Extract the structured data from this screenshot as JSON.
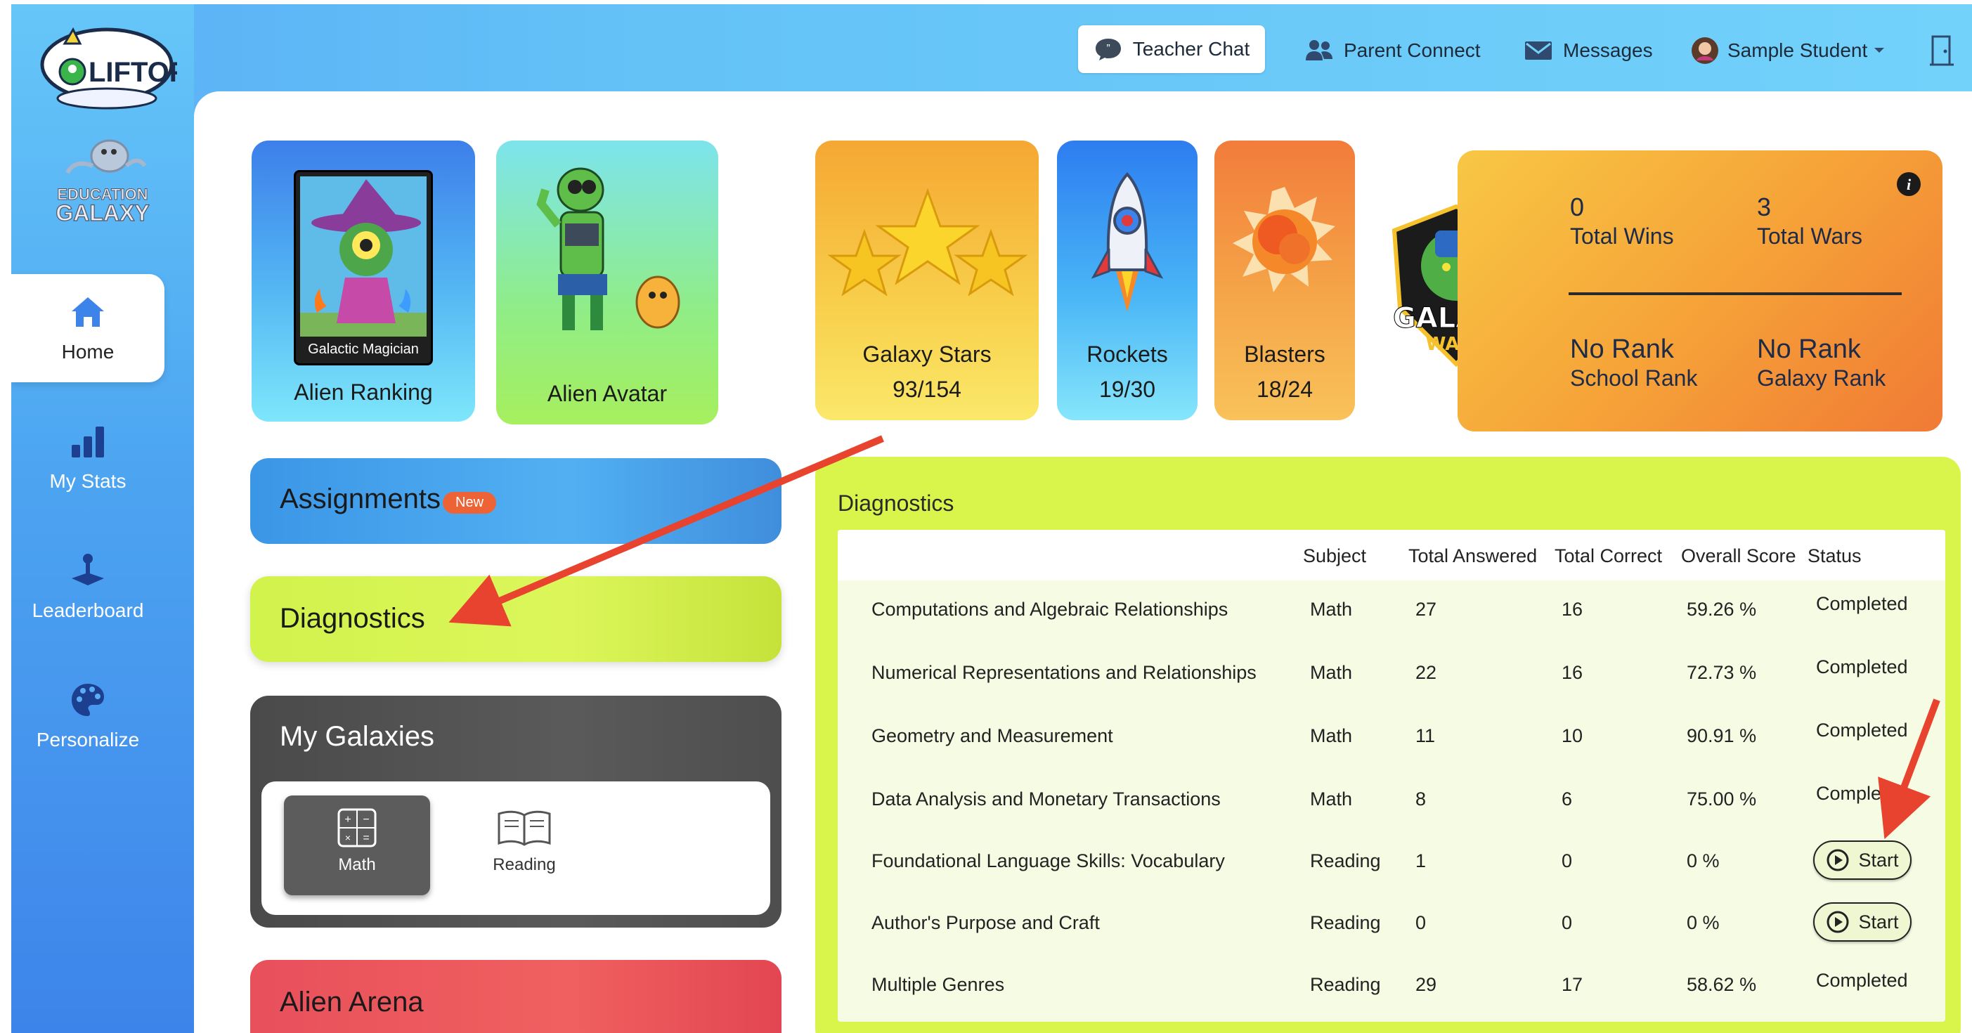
{
  "header": {
    "teacher_chat": "Teacher Chat",
    "parent_connect": "Parent Connect",
    "messages": "Messages",
    "user_name": "Sample Student"
  },
  "logos": {
    "liftoff": "LIFTOFF",
    "education_galaxy_line1": "EDUCATION",
    "education_galaxy_line2": "GALAXY"
  },
  "sidebar": {
    "items": [
      {
        "label": "Home",
        "icon": "home-icon",
        "active": true
      },
      {
        "label": "My Stats",
        "icon": "bar-chart-icon",
        "active": false
      },
      {
        "label": "Leaderboard",
        "icon": "joystick-icon",
        "active": false
      },
      {
        "label": "Personalize",
        "icon": "palette-icon",
        "active": false
      }
    ]
  },
  "cards": {
    "alien_ranking": {
      "label": "Alien Ranking",
      "badge": "Galactic Magician"
    },
    "alien_avatar": {
      "label": "Alien Avatar"
    },
    "galaxy_stars": {
      "label": "Galaxy Stars",
      "value": "93/154"
    },
    "rockets": {
      "label": "Rockets",
      "value": "19/30"
    },
    "blasters": {
      "label": "Blasters",
      "value": "18/24"
    }
  },
  "galaxy_wars": {
    "logo_line1": "GALAXY",
    "logo_line2": "WARS",
    "total_wins_value": "0",
    "total_wins_label": "Total Wins",
    "total_wars_value": "3",
    "total_wars_label": "Total Wars",
    "school_rank_value": "No Rank",
    "school_rank_label": "School Rank",
    "galaxy_rank_value": "No Rank",
    "galaxy_rank_label": "Galaxy Rank"
  },
  "sections": {
    "assignments": {
      "title": "Assignments",
      "badge": "New"
    },
    "diagnostics": {
      "title": "Diagnostics"
    },
    "my_galaxies": {
      "title": "My Galaxies",
      "math": "Math",
      "reading": "Reading"
    },
    "alien_arena": {
      "title": "Alien Arena"
    }
  },
  "diagnostics": {
    "title": "Diagnostics",
    "columns": [
      "Subject",
      "Total Answered",
      "Total Correct",
      "Overall Score",
      "Status"
    ],
    "start_label": "Start",
    "rows": [
      {
        "name": "Computations and Algebraic Relationships",
        "subject": "Math",
        "answered": "27",
        "correct": "16",
        "score": "59.26 %",
        "status": "Completed"
      },
      {
        "name": "Numerical Representations and Relationships",
        "subject": "Math",
        "answered": "22",
        "correct": "16",
        "score": "72.73 %",
        "status": "Completed"
      },
      {
        "name": "Geometry and Measurement",
        "subject": "Math",
        "answered": "11",
        "correct": "10",
        "score": "90.91 %",
        "status": "Completed"
      },
      {
        "name": "Data Analysis and Monetary Transactions",
        "subject": "Math",
        "answered": "8",
        "correct": "6",
        "score": "75.00 %",
        "status": "Completed"
      },
      {
        "name": "Foundational Language Skills: Vocabulary",
        "subject": "Reading",
        "answered": "1",
        "correct": "0",
        "score": "0 %",
        "status": "Start"
      },
      {
        "name": "Author's Purpose and Craft",
        "subject": "Reading",
        "answered": "0",
        "correct": "0",
        "score": "0 %",
        "status": "Start"
      },
      {
        "name": "Multiple Genres",
        "subject": "Reading",
        "answered": "29",
        "correct": "17",
        "score": "58.62 %",
        "status": "Completed"
      }
    ]
  },
  "colors": {
    "accent_blue": "#3d84ea",
    "diagnostics_green": "#d9f54b",
    "assignments_blue": "#3b96e6",
    "arena_red": "#e8505b",
    "galaxies_gray": "#555555",
    "annotation_red": "#e8432f"
  }
}
